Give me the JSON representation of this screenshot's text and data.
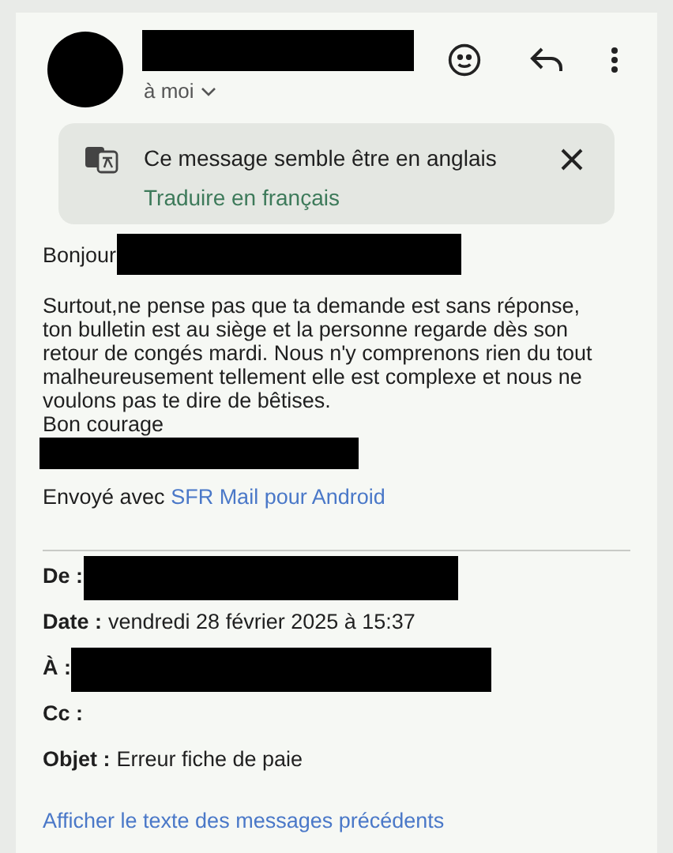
{
  "header": {
    "recipient": "à moi"
  },
  "translate_banner": {
    "message": "Ce message semble être en anglais",
    "action": "Traduire en français"
  },
  "body": {
    "greeting": "Bonjour",
    "paragraph": "Surtout,ne pense pas que ta demande est sans réponse, ton bulletin est au siège et la personne regarde dès son retour de congés mardi. Nous n'y comprenons rien du tout malheureusement tellement elle est complexe et nous ne voulons pas te dire de bêtises.",
    "closing": "Bon courage",
    "signature_prefix": "Envoyé avec",
    "signature_link": "SFR Mail pour Android"
  },
  "quoted_header": [
    {
      "label": "De :",
      "kind": "redacted"
    },
    {
      "label": "Date :",
      "kind": "text",
      "value": "vendredi 28 février 2025 à 15:37"
    },
    {
      "label": "À :",
      "kind": "redacted"
    },
    {
      "label": "Cc :",
      "kind": "empty"
    },
    {
      "label": "Objet :",
      "kind": "text",
      "value": "Erreur fiche de paie"
    }
  ],
  "show_previous": "Afficher le texte des messages précédents"
}
